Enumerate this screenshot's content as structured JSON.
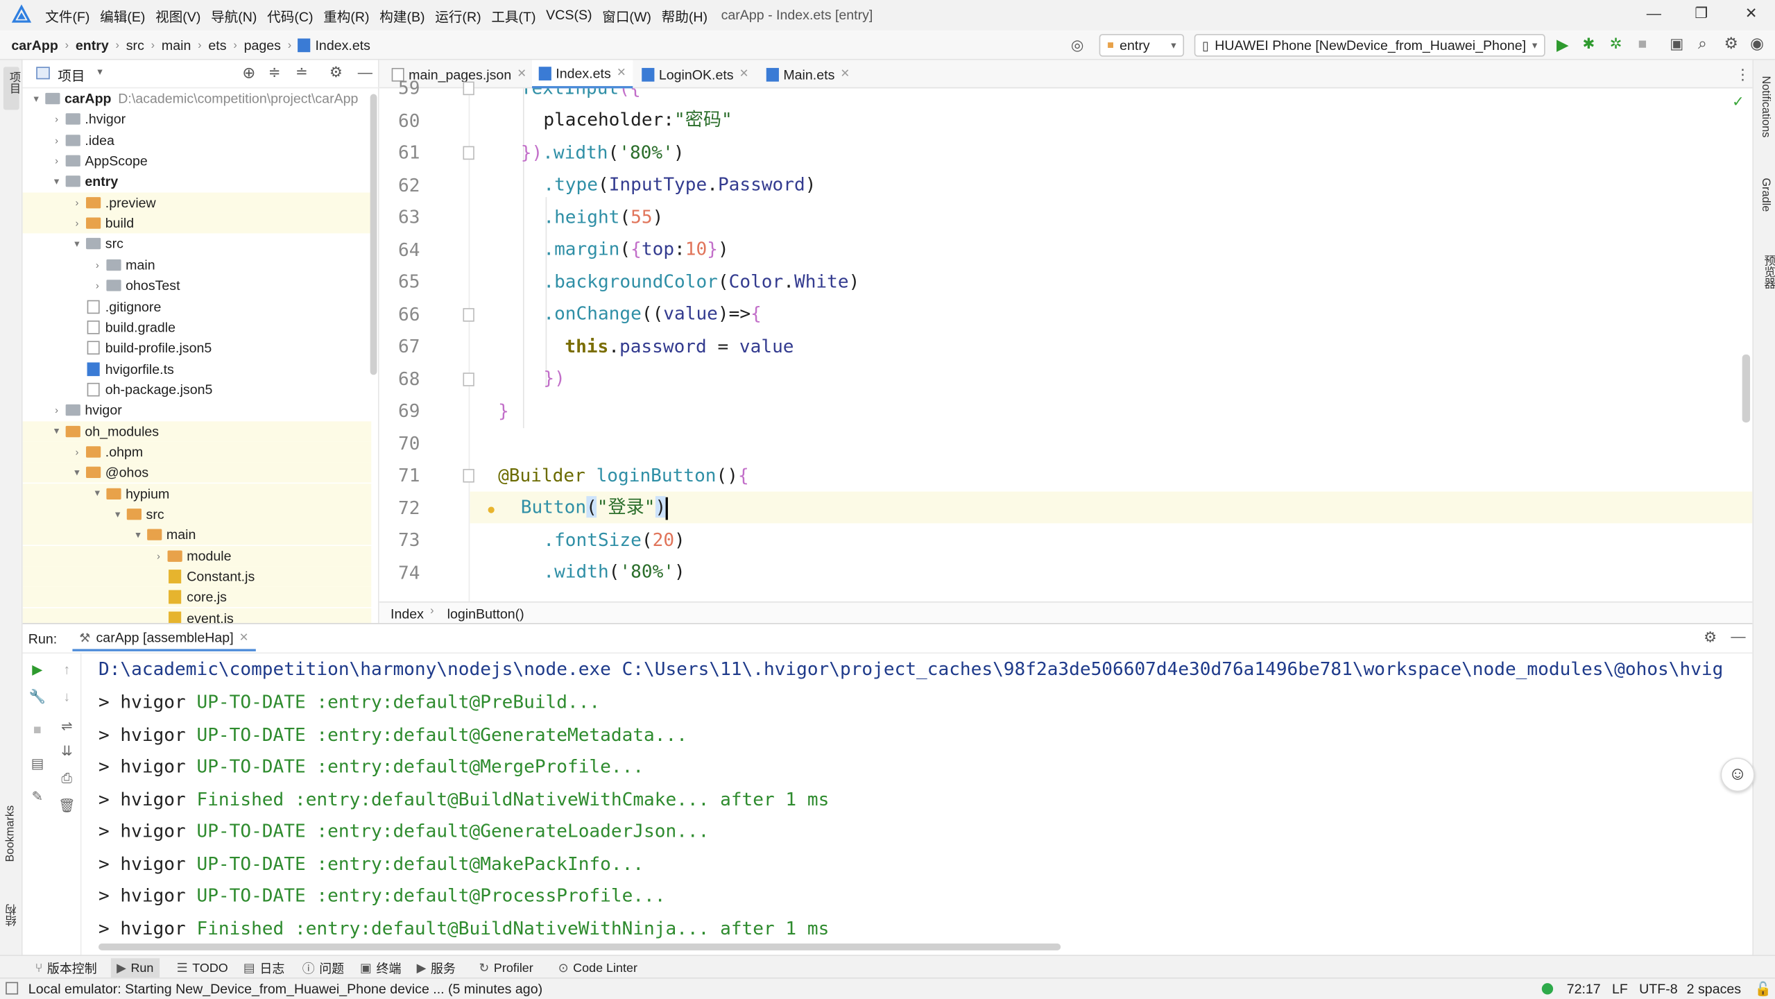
{
  "titlebar": {
    "menu": [
      "文件(F)",
      "编辑(E)",
      "视图(V)",
      "导航(N)",
      "代码(C)",
      "重构(R)",
      "构建(B)",
      "运行(R)",
      "工具(T)",
      "VCS(S)",
      "窗口(W)",
      "帮助(H)"
    ],
    "window_title": "carApp - Index.ets [entry]",
    "minimize": "—",
    "restore": "❐",
    "close": "✕"
  },
  "navbar": {
    "crumbs": [
      "carApp",
      "entry",
      "src",
      "main",
      "ets",
      "pages",
      "Index.ets"
    ],
    "module_select": "entry",
    "device_select": "HUAWEI Phone [NewDevice_from_Huawei_Phone]"
  },
  "left_strip": {
    "project": "项目",
    "bookmarks": "Bookmarks",
    "structure": "结构"
  },
  "right_strip": {
    "notifications": "Notifications",
    "gradle": "Gradle",
    "preview": "预览器"
  },
  "project_panel": {
    "title": "项目",
    "tree": [
      {
        "label": "carApp",
        "path": "D:\\academic\\competition\\project\\carApp",
        "depth": 0,
        "arrow": "▾",
        "kind": "grey",
        "bold": true
      },
      {
        "label": ".hvigor",
        "depth": 1,
        "arrow": "›",
        "kind": "grey"
      },
      {
        "label": ".idea",
        "depth": 1,
        "arrow": "›",
        "kind": "grey"
      },
      {
        "label": "AppScope",
        "depth": 1,
        "arrow": "›",
        "kind": "grey"
      },
      {
        "label": "entry",
        "depth": 1,
        "arrow": "▾",
        "kind": "grey",
        "bold": true
      },
      {
        "label": ".preview",
        "depth": 2,
        "arrow": "›",
        "kind": "orange",
        "hl": true
      },
      {
        "label": "build",
        "depth": 2,
        "arrow": "›",
        "kind": "orange",
        "hl": true
      },
      {
        "label": "src",
        "depth": 2,
        "arrow": "▾",
        "kind": "grey"
      },
      {
        "label": "main",
        "depth": 3,
        "arrow": "›",
        "kind": "grey"
      },
      {
        "label": "ohosTest",
        "depth": 3,
        "arrow": "›",
        "kind": "grey"
      },
      {
        "label": ".gitignore",
        "depth": 2,
        "arrow": "",
        "kind": "file"
      },
      {
        "label": "build.gradle",
        "depth": 2,
        "arrow": "",
        "kind": "file"
      },
      {
        "label": "build-profile.json5",
        "depth": 2,
        "arrow": "",
        "kind": "file"
      },
      {
        "label": "hvigorfile.ts",
        "depth": 2,
        "arrow": "",
        "kind": "ts"
      },
      {
        "label": "oh-package.json5",
        "depth": 2,
        "arrow": "",
        "kind": "file"
      },
      {
        "label": "hvigor",
        "depth": 1,
        "arrow": "›",
        "kind": "grey"
      },
      {
        "label": "oh_modules",
        "depth": 1,
        "arrow": "▾",
        "kind": "orange",
        "hl": true
      },
      {
        "label": ".ohpm",
        "depth": 2,
        "arrow": "›",
        "kind": "orange",
        "hl": true
      },
      {
        "label": "@ohos",
        "depth": 2,
        "arrow": "▾",
        "kind": "orange",
        "hl": true
      },
      {
        "label": "hypium",
        "depth": 3,
        "arrow": "▾",
        "kind": "orange",
        "hl": true
      },
      {
        "label": "src",
        "depth": 4,
        "arrow": "▾",
        "kind": "orange",
        "hl": true
      },
      {
        "label": "main",
        "depth": 5,
        "arrow": "▾",
        "kind": "orange",
        "hl": true
      },
      {
        "label": "module",
        "depth": 6,
        "arrow": "›",
        "kind": "orange",
        "hl": true
      },
      {
        "label": "Constant.js",
        "depth": 6,
        "arrow": "",
        "kind": "js",
        "hl": true
      },
      {
        "label": "core.js",
        "depth": 6,
        "arrow": "",
        "kind": "js",
        "hl": true
      },
      {
        "label": "event.js",
        "depth": 6,
        "arrow": "",
        "kind": "js",
        "hl": true
      }
    ]
  },
  "editor": {
    "tabs": [
      {
        "label": "main_pages.json",
        "active": false
      },
      {
        "label": "Index.ets",
        "active": true
      },
      {
        "label": "LoginOK.ets",
        "active": false
      },
      {
        "label": "Main.ets",
        "active": false
      }
    ],
    "line_numbers": [
      "59",
      "60",
      "61",
      "62",
      "63",
      "64",
      "65",
      "66",
      "67",
      "68",
      "69",
      "70",
      "71",
      "72",
      "73",
      "74"
    ],
    "breadcrumb": [
      "Index",
      "loginButton()"
    ]
  },
  "run_panel": {
    "label": "Run:",
    "config": "carApp [assembleHap]",
    "command": "D:\\academic\\competition\\harmony\\nodejs\\node.exe C:\\Users\\11\\.hvigor\\project_caches\\98f2a3de506607d4e30d76a1496be781\\workspace\\node_modules\\@ohos\\hvig",
    "lines": [
      {
        "prefix": "> hvigor ",
        "status": "UP-TO-DATE",
        "task": " :entry:default@PreBuild...",
        "tail": ""
      },
      {
        "prefix": "> hvigor ",
        "status": "UP-TO-DATE",
        "task": " :entry:default@GenerateMetadata...",
        "tail": ""
      },
      {
        "prefix": "> hvigor ",
        "status": "UP-TO-DATE",
        "task": " :entry:default@MergeProfile...",
        "tail": ""
      },
      {
        "prefix": "> hvigor ",
        "status": "Finished",
        "task": " :entry:default@BuildNativeWithCmake...",
        "tail": " after 1 ms"
      },
      {
        "prefix": "> hvigor ",
        "status": "UP-TO-DATE",
        "task": " :entry:default@GenerateLoaderJson...",
        "tail": ""
      },
      {
        "prefix": "> hvigor ",
        "status": "UP-TO-DATE",
        "task": " :entry:default@MakePackInfo...",
        "tail": ""
      },
      {
        "prefix": "> hvigor ",
        "status": "UP-TO-DATE",
        "task": " :entry:default@ProcessProfile...",
        "tail": ""
      },
      {
        "prefix": "> hvigor ",
        "status": "Finished",
        "task": " :entry:default@BuildNativeWithNinja...",
        "tail": " after 1 ms"
      }
    ]
  },
  "bottom_tabs": [
    "版本控制",
    "Run",
    "TODO",
    "日志",
    "问题",
    "终端",
    "服务",
    "Profiler",
    "Code Linter"
  ],
  "status_bar": {
    "message": "Local emulator: Starting New_Device_from_Huawei_Phone device ... (5 minutes ago)",
    "position": "72:17",
    "line_sep": "LF",
    "encoding": "UTF-8",
    "indent": "2 spaces"
  },
  "colors": {
    "accent": "#4a8ad8",
    "run_green": "#2e8b2e",
    "folder_orange": "#e8a24a"
  }
}
